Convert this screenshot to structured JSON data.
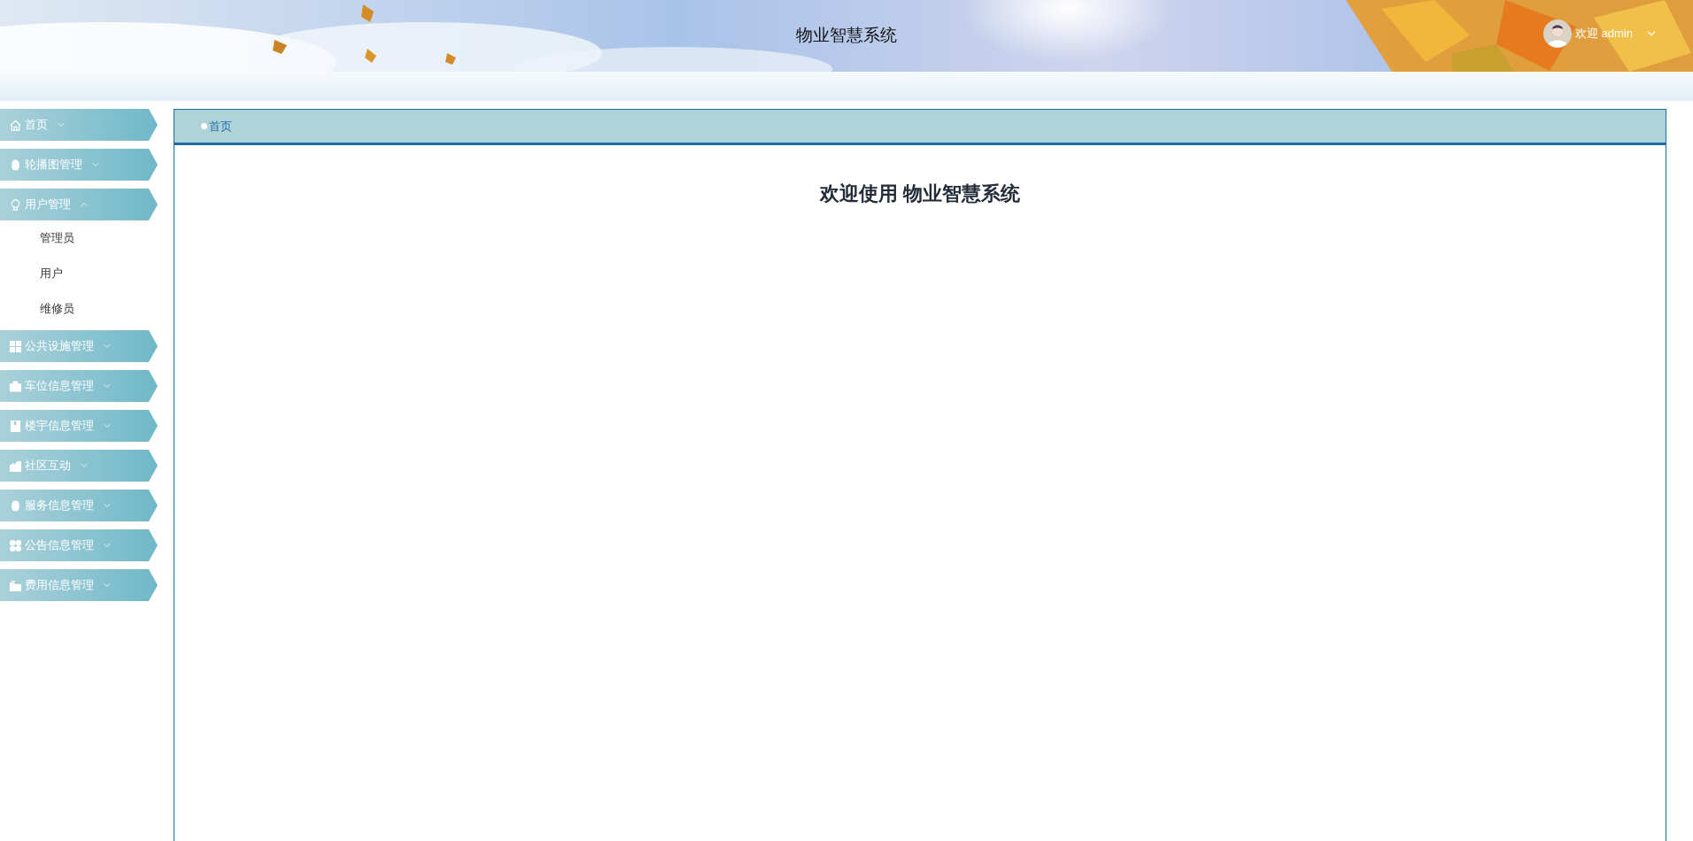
{
  "header": {
    "title": "物业智慧系统",
    "user_label": "欢迎 admin"
  },
  "sidebar": {
    "items": [
      {
        "label": "首页",
        "expanded": false
      },
      {
        "label": "轮播图管理",
        "expanded": false
      },
      {
        "label": "用户管理",
        "expanded": true,
        "children": [
          {
            "label": "管理员"
          },
          {
            "label": "用户"
          },
          {
            "label": "维修员"
          }
        ]
      },
      {
        "label": "公共设施管理",
        "expanded": false
      },
      {
        "label": "车位信息管理",
        "expanded": false
      },
      {
        "label": "楼宇信息管理",
        "expanded": false
      },
      {
        "label": "社区互动",
        "expanded": false
      },
      {
        "label": "服务信息管理",
        "expanded": false
      },
      {
        "label": "公告信息管理",
        "expanded": false
      },
      {
        "label": "费用信息管理",
        "expanded": false
      }
    ]
  },
  "breadcrumb": [
    "首页"
  ],
  "welcome": "欢迎使用 物业智慧系统"
}
